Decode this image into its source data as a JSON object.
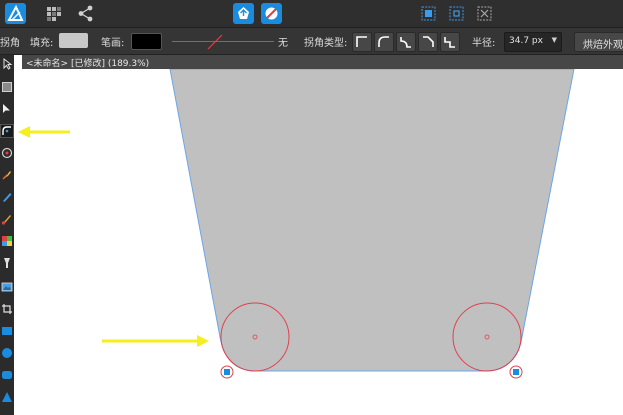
{
  "colors": {
    "toolbar_bg": "#2f2f2f",
    "context_bg": "#353535",
    "accent_blue": "#1a8ce0",
    "shape_fill": "#c0c0c0",
    "shape_stroke": "#6aa6e8",
    "guide_red": "#e0404c",
    "arrow_yellow": "#f6ee1e"
  },
  "topbar": {
    "icons": [
      "affinity-designer-logo-icon",
      "persona-pixel-icon",
      "persona-export-icon",
      "snapping-icon",
      "hide-selection-icon",
      "insert-behind-icon",
      "insert-inside-icon",
      "insert-top-icon"
    ]
  },
  "context": {
    "tool_name": "拐角",
    "fill_label": "填充:",
    "fill_color": "#c8c8c8",
    "stroke_label": "笔画:",
    "stroke_color": "#000000",
    "stroke_width_value": "无",
    "corner_type_label": "拐角类型:",
    "radius_label": "半径:",
    "radius_value": "34.7 px",
    "apply_button": "烘焙外观"
  },
  "document": {
    "tab_title": "<未命名> [已修改] (189.3%)"
  },
  "tools": {
    "items": [
      "move-tool-icon",
      "artboard-tool-icon",
      "node-tool-icon",
      "corner-tool-icon",
      "point-transform-icon",
      "pen-tool-icon",
      "pencil-tool-icon",
      "vector-brush-icon",
      "fill-tool-icon",
      "transparency-tool-icon",
      "place-image-icon",
      "crop-tool-icon",
      "rectangle-tool-icon",
      "ellipse-tool-icon",
      "rounded-rect-tool-icon",
      "triangle-tool-icon"
    ],
    "selected_index": 3
  }
}
